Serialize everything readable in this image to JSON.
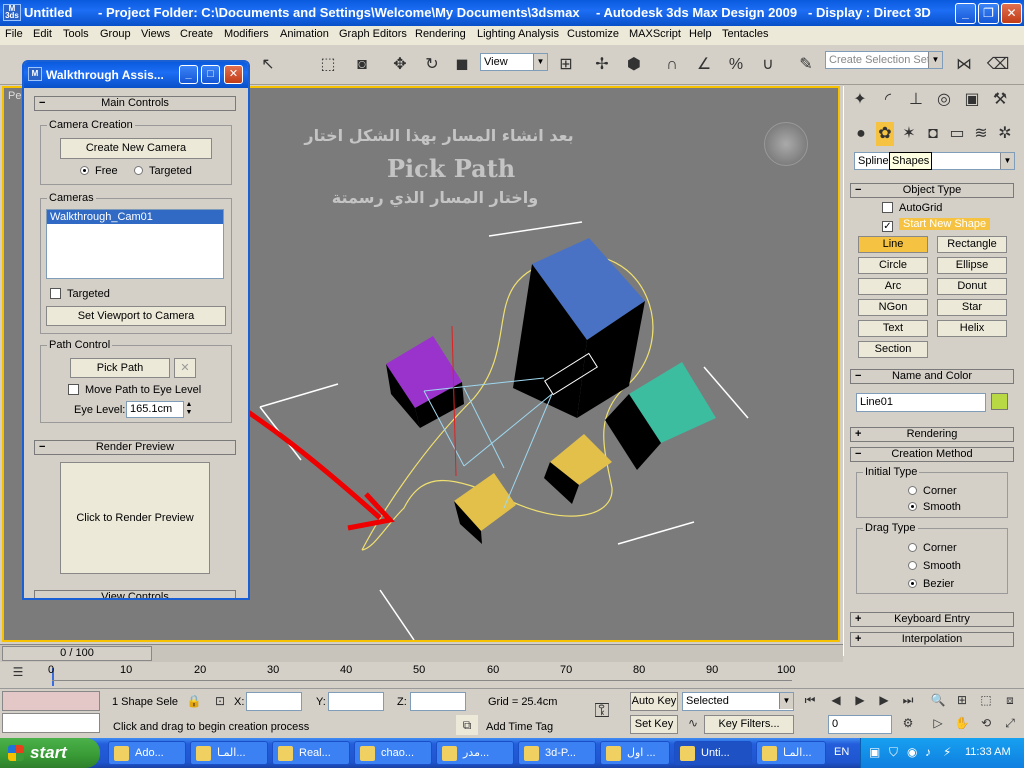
{
  "title": {
    "app_name": "Untitled",
    "project": "- Project Folder: C:\\Documents and Settings\\Welcome\\My Documents\\3dsmax",
    "product": "- Autodesk 3ds Max Design 2009",
    "display": "- Display : Direct 3D"
  },
  "menu": [
    "File",
    "Edit",
    "Tools",
    "Group",
    "Views",
    "Create",
    "Modifiers",
    "Animation",
    "Graph Editors",
    "Rendering",
    "Lighting Analysis",
    "Customize",
    "MAXScript",
    "Help",
    "Tentacles"
  ],
  "toolbar": {
    "view_select": "View",
    "selection_set_placeholder": "Create Selection Set"
  },
  "viewport": {
    "label": "Pe",
    "annotation_line1": "بعد انشاء المسار بهذا الشكل اختار",
    "annotation_line2": "Pick Path",
    "annotation_line3": "واختار المسار الذي رسمتة"
  },
  "dialog": {
    "title": "Walkthrough Assis...",
    "main_controls": "Main Controls",
    "camera_creation": "Camera Creation",
    "create_new_camera": "Create New Camera",
    "free": "Free",
    "targeted": "Targeted",
    "cameras": "Cameras",
    "camera_list": [
      "Walkthrough_Cam01"
    ],
    "targeted_check": "Targeted",
    "set_viewport": "Set Viewport to Camera",
    "path_control": "Path Control",
    "pick_path": "Pick Path",
    "move_path": "Move Path to Eye Level",
    "eye_level_label": "Eye Level:",
    "eye_level_value": "165.1cm",
    "render_preview": "Render Preview",
    "click_to_render": "Click to Render Preview",
    "view_controls": "View Controls"
  },
  "command_panel": {
    "category": "Splines",
    "category_tooltip": "Shapes",
    "object_type": "Object Type",
    "autogrid": "AutoGrid",
    "start_new_shape": "Start New Shape",
    "shapes": [
      "Line",
      "Rectangle",
      "Circle",
      "Ellipse",
      "Arc",
      "Donut",
      "NGon",
      "Star",
      "Text",
      "Helix",
      "Section"
    ],
    "name_and_color": "Name and Color",
    "object_name": "Line01",
    "object_color": "#b8d844",
    "rendering": "Rendering",
    "creation_method": "Creation Method",
    "initial_type": "Initial Type",
    "drag_type": "Drag Type",
    "corner": "Corner",
    "smooth": "Smooth",
    "bezier": "Bezier",
    "keyboard_entry": "Keyboard Entry",
    "interpolation": "Interpolation"
  },
  "timeline": {
    "frame": "0 / 100",
    "ticks": [
      "0",
      "10",
      "20",
      "30",
      "40",
      "50",
      "60",
      "70",
      "80",
      "90",
      "100"
    ]
  },
  "status": {
    "selection": "1 Shape Sele",
    "x_label": "X:",
    "y_label": "Y:",
    "z_label": "Z:",
    "grid": "Grid = 25.4cm",
    "prompt": "Click and drag to begin creation process",
    "add_time_tag": "Add Time Tag",
    "auto_key": "Auto Key",
    "set_key": "Set Key",
    "selected": "Selected",
    "key_filters": "Key Filters...",
    "frame_field": "0"
  },
  "taskbar": {
    "start": "start",
    "tasks": [
      "Ado...",
      "المـا...",
      "Real...",
      "chao...",
      "مدر...",
      "3d-P...",
      "اول ...",
      "Unti...",
      "المـا..."
    ],
    "language": "EN",
    "clock": "11:33 AM"
  }
}
